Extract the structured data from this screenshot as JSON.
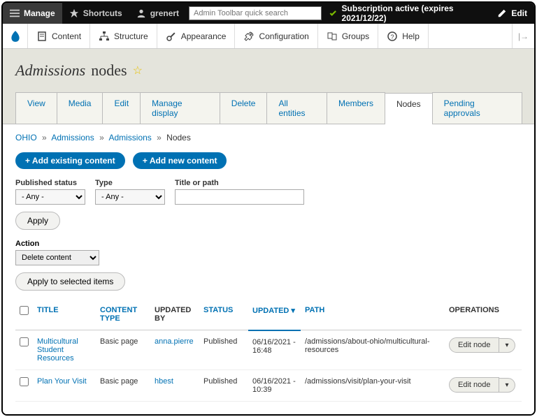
{
  "topbar": {
    "manage": "Manage",
    "shortcuts": "Shortcuts",
    "user": "grenert",
    "search_placeholder": "Admin Toolbar quick search",
    "subscription": "Subscription active (expires 2021/12/22)",
    "edit": "Edit"
  },
  "navbar": {
    "items": [
      "Content",
      "Structure",
      "Appearance",
      "Configuration",
      "Groups",
      "Help"
    ]
  },
  "page": {
    "title_italic": "Admissions",
    "title_rest": "nodes"
  },
  "tabs": {
    "items": [
      "View",
      "Media",
      "Edit",
      "Manage display",
      "Delete",
      "All entities",
      "Members",
      "Nodes",
      "Pending approvals"
    ],
    "active_index": 7
  },
  "breadcrumb": {
    "items": [
      "OHIO",
      "Admissions",
      "Admissions"
    ],
    "current": "Nodes"
  },
  "buttons": {
    "add_existing": "+ Add existing content",
    "add_new": "+ Add new content",
    "apply": "Apply",
    "apply_selected": "Apply to selected items"
  },
  "filters": {
    "published_label": "Published status",
    "published_value": "- Any -",
    "type_label": "Type",
    "type_value": "- Any -",
    "title_label": "Title or path"
  },
  "action": {
    "label": "Action",
    "value": "Delete content"
  },
  "table": {
    "headers": {
      "title": "TITLE",
      "content_type": "CONTENT TYPE",
      "updated_by": "UPDATED BY",
      "status": "STATUS",
      "updated": "UPDATED",
      "path": "PATH",
      "operations": "OPERATIONS"
    },
    "rows": [
      {
        "title": "Multicultural Student Resources",
        "content_type": "Basic page",
        "updated_by": "anna.pierre",
        "status": "Published",
        "updated": "06/16/2021 - 16:48",
        "path": "/admissions/about-ohio/multicultural-resources",
        "op": "Edit node"
      },
      {
        "title": "Plan Your Visit",
        "content_type": "Basic page",
        "updated_by": "hbest",
        "status": "Published",
        "updated": "06/16/2021 - 10:39",
        "path": "/admissions/visit/plan-your-visit",
        "op": "Edit node"
      }
    ]
  }
}
